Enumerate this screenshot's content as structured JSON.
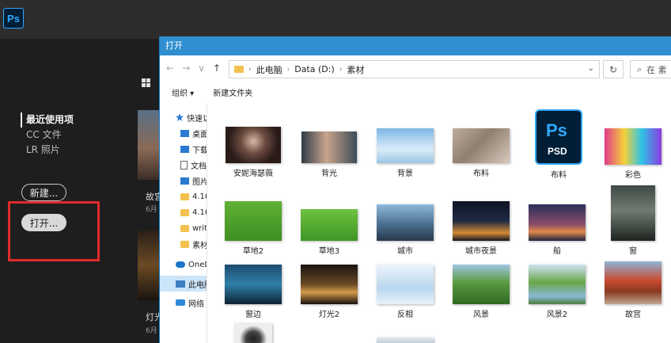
{
  "app": {
    "logo_text": "Ps",
    "accent": "#31a8ff"
  },
  "home": {
    "nav": [
      "最近使用项",
      "CC 文件",
      "LR 照片"
    ],
    "new_button": "新建...",
    "open_button": "打开...",
    "recent": [
      {
        "title": "故宫",
        "date": "6月"
      },
      {
        "title": "灯光",
        "date": "6月"
      }
    ]
  },
  "dialog": {
    "title": "打开",
    "breadcrumb": [
      "此电脑",
      "Data (D:)",
      "素材"
    ],
    "search_placeholder": "在 素",
    "toolbar": {
      "organize": "组织 ▾",
      "new_folder": "新建文件夹"
    },
    "sidebar": [
      {
        "label": "快速访问",
        "icon": "star-icon"
      },
      {
        "label": "桌面",
        "icon": "desktop-icon",
        "pinned": true
      },
      {
        "label": "下载",
        "icon": "download-icon",
        "pinned": true
      },
      {
        "label": "文档",
        "icon": "document-icon",
        "pinned": true
      },
      {
        "label": "图片",
        "icon": "picture-icon",
        "pinned": true
      },
      {
        "label": "4.16",
        "icon": "folder-icon"
      },
      {
        "label": "4.16",
        "icon": "folder-icon"
      },
      {
        "label": "writ",
        "icon": "folder-icon"
      },
      {
        "label": "素材",
        "icon": "folder-icon"
      },
      {
        "label": "OneDrive",
        "icon": "cloud-icon"
      },
      {
        "label": "此电脑",
        "icon": "computer-icon",
        "selected": true
      },
      {
        "label": "网络",
        "icon": "network-icon"
      }
    ],
    "files": [
      "安妮海瑟薇",
      "背光",
      "背景",
      "布料",
      "布料",
      "彩色",
      "草地2",
      "草地3",
      "城市",
      "城市夜景",
      "船",
      "窗",
      "窗边",
      "灯光2",
      "反相",
      "风景",
      "风景2",
      "故宫",
      "",
      ""
    ]
  }
}
